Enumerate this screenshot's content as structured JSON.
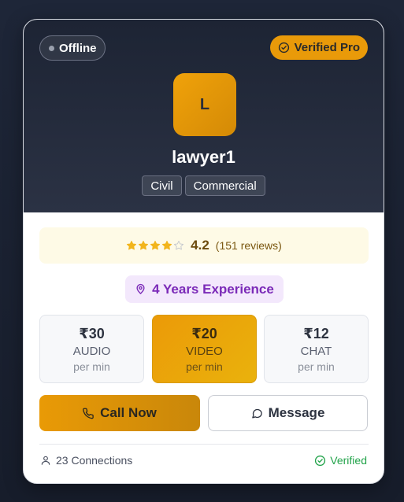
{
  "card": {
    "status": "Offline",
    "badge": "Verified Pro",
    "avatar_initial": "L",
    "name": "lawyer1",
    "tags": [
      "Civil",
      "Commercial"
    ],
    "rating": {
      "stars_filled": 4,
      "stars_total": 5,
      "value": "4.2",
      "reviews": "(151 reviews)"
    },
    "experience": "4 Years Experience",
    "prices": [
      {
        "amount": "₹30",
        "type": "AUDIO",
        "unit": "per min",
        "selected": false
      },
      {
        "amount": "₹20",
        "type": "VIDEO",
        "unit": "per min",
        "selected": true
      },
      {
        "amount": "₹12",
        "type": "CHAT",
        "unit": "per min",
        "selected": false
      }
    ],
    "buttons": {
      "call": "Call Now",
      "message": "Message"
    },
    "footer": {
      "connections": "23 Connections",
      "verified": "Verified"
    },
    "colors": {
      "accent": "#e99a09",
      "purple": "#7b2ab8",
      "success": "#22a34a"
    },
    "icons": {
      "badge": "check-circle-icon",
      "experience": "map-pin-icon",
      "call": "phone-icon",
      "message": "chat-bubble-icon",
      "connections": "user-icon",
      "verified": "check-circle-icon"
    }
  }
}
